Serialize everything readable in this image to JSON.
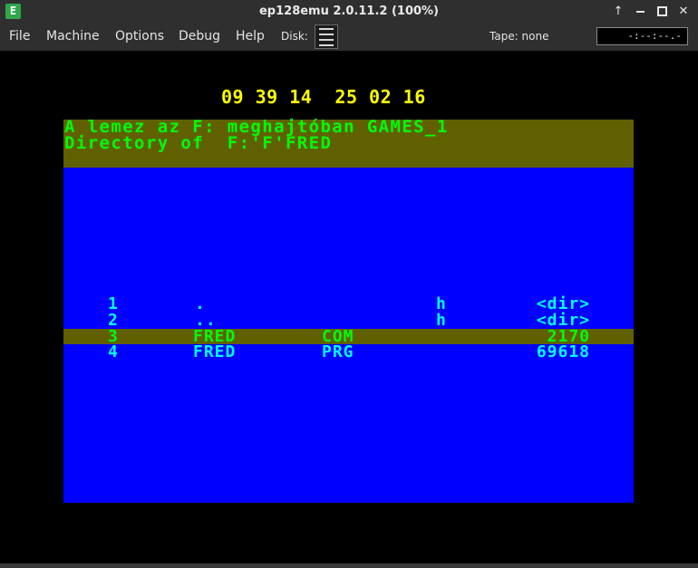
{
  "window": {
    "title": "ep128emu 2.0.11.2 (100%)",
    "app_icon_letter": "E",
    "controls": [
      "up-arrow",
      "minimize",
      "maximize",
      "close"
    ]
  },
  "menu": {
    "items": [
      {
        "label": "File"
      },
      {
        "label": "Machine"
      },
      {
        "label": "Options"
      },
      {
        "label": "Debug"
      },
      {
        "label": "Help"
      }
    ],
    "disk_label": "Disk:",
    "tape_label": "Tape: none",
    "tape_counter": "-:--:--.-"
  },
  "screen": {
    "clock": "09 39 14  25 02 16",
    "header_line1": "A lemez az F: meghajtóban GAMES_1",
    "header_line2": "Directory of  F:'F'FRED",
    "rows": [
      {
        "num": "1",
        "name": ".",
        "ext": "",
        "attr": "h",
        "size": "<dir>",
        "highlighted": false
      },
      {
        "num": "2",
        "name": "..",
        "ext": "",
        "attr": "h",
        "size": "<dir>",
        "highlighted": false
      },
      {
        "num": "3",
        "name": "FRED",
        "ext": "COM",
        "attr": "",
        "size": "2170",
        "highlighted": true
      },
      {
        "num": "4",
        "name": "FRED",
        "ext": "PRG",
        "attr": "",
        "size": "69618",
        "highlighted": false
      }
    ],
    "colors": {
      "background": "#0000ff",
      "band": "#606000",
      "clock": "#ffff00",
      "header_text": "#00ff00",
      "row_text": "#00ffff",
      "highlight_text": "#00ff00"
    }
  }
}
